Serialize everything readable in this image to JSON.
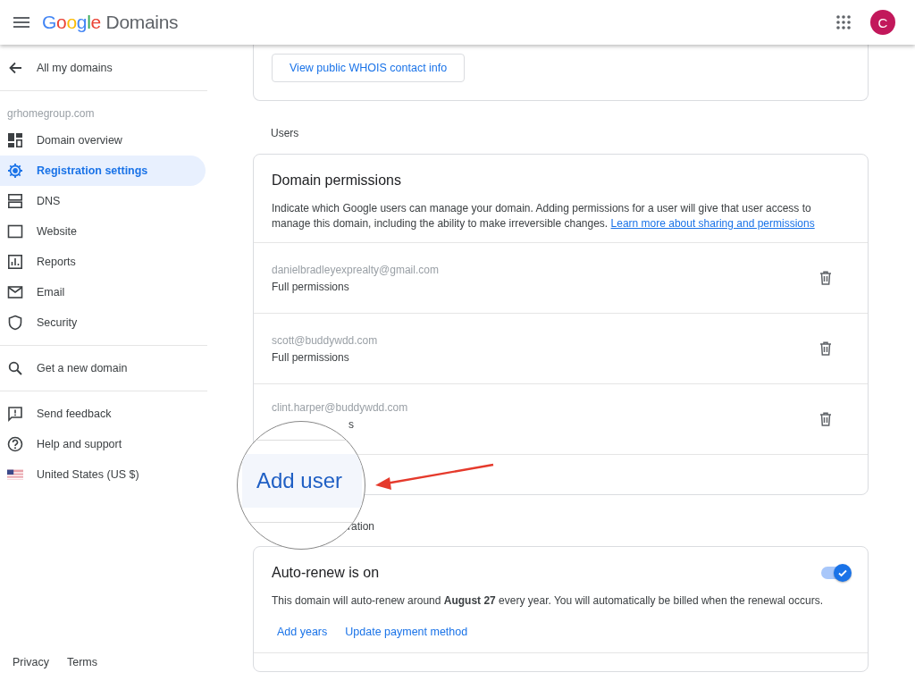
{
  "header": {
    "logo_google": "Google",
    "logo_product": "Domains",
    "avatar": "C"
  },
  "sidebar": {
    "back": "All my domains",
    "domain": "grhomegroup.com",
    "nav": [
      {
        "label": "Domain overview",
        "selected": false
      },
      {
        "label": "Registration settings",
        "selected": true
      },
      {
        "label": "DNS",
        "selected": false
      },
      {
        "label": "Website",
        "selected": false
      },
      {
        "label": "Reports",
        "selected": false
      },
      {
        "label": "Email",
        "selected": false
      },
      {
        "label": "Security",
        "selected": false
      }
    ],
    "search": "Get a new domain",
    "links": [
      "Send feedback",
      "Help and support",
      "United States (US $)"
    ],
    "footer": [
      "Privacy",
      "Terms"
    ]
  },
  "whois_button": "View public WHOIS contact info",
  "users_section": "Users",
  "permissions": {
    "title": "Domain permissions",
    "description": "Indicate which Google users can manage your domain. Adding permissions for a user will give that user access to manage this domain, including the ability to make irreversible changes. ",
    "link": "Learn more about sharing and permissions",
    "users": [
      {
        "email": "danielbradleyexprealty@gmail.com",
        "role": "Full permissions",
        "covered": false
      },
      {
        "email": "scott@buddywdd.com",
        "role": "Full permissions",
        "covered": false
      },
      {
        "email": "clint.harper@buddywdd.com",
        "role": "s",
        "covered": true
      }
    ]
  },
  "renewal_section": "ration",
  "autorenew": {
    "title": "Auto-renew is on",
    "on": true,
    "text": "This domain will auto-renew around **August 27** every year. You will automatically be billed when the renewal occurs.",
    "links": [
      "Add years",
      "Update payment method"
    ]
  },
  "callout": "Add user"
}
